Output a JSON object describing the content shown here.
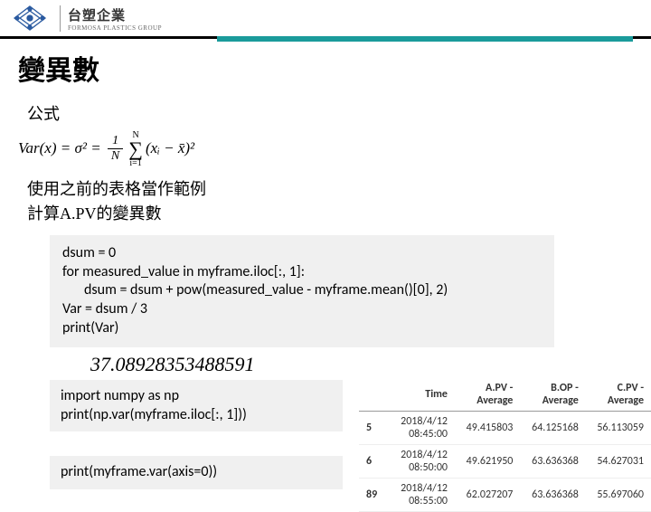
{
  "brand": {
    "name": "台塑企業",
    "sub": "FORMOSA PLASTICS GROUP"
  },
  "title": "變異數",
  "formula_label": "公式",
  "formula": {
    "lhs": "Var(x) = σ",
    "eq": "² = ",
    "sum_top": "N",
    "sum_bot": "i=1",
    "term": "(xᵢ − x̄)",
    "pow": "²",
    "num": "1",
    "den": "N"
  },
  "desc1": "使用之前的表格當作範例",
  "desc2": "計算A.PV的變異數",
  "code1": {
    "l1": "dsum = 0",
    "l2": "for measured_value in myframe.iloc[:, 1]:",
    "l3": "dsum = dsum + pow(measured_value - myframe.mean()[0], 2)",
    "l4": "Var = dsum / 3",
    "l5": "print(Var)"
  },
  "output": "37.08928353488591",
  "code2": {
    "l1": "import numpy as np",
    "l2": "print(np.var(myframe.iloc[:, 1]))",
    "l3": "print(myframe.var(axis=0))"
  },
  "table": {
    "headers": [
      "",
      "Time",
      "A.PV - Average",
      "B.OP - Average",
      "C.PV - Average"
    ],
    "rows": [
      [
        "5",
        "2018/4/12 08:45:00",
        "49.415803",
        "64.125168",
        "56.113059"
      ],
      [
        "6",
        "2018/4/12 08:50:00",
        "49.621950",
        "63.636368",
        "54.627031"
      ],
      [
        "89",
        "2018/4/12 08:55:00",
        "62.027207",
        "63.636368",
        "55.697060"
      ]
    ]
  }
}
